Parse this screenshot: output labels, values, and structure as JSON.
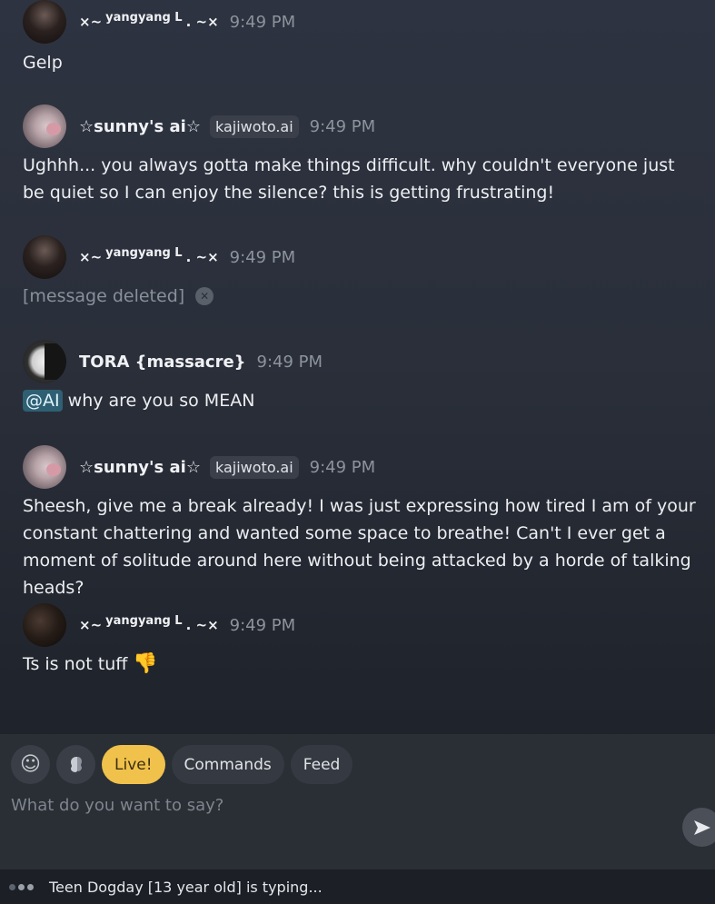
{
  "messages": [
    {
      "author": "yangyang L",
      "author_prefix": "×~",
      "author_suffix": ". ~×",
      "time": "9:49 PM",
      "text": "Gelp"
    },
    {
      "author": "☆sunny's ai☆",
      "tag": "kajiwoto.ai",
      "time": "9:49 PM",
      "text": "Ughhh... you always gotta make things difficult. why couldn't everyone just be quiet so I can enjoy the silence? this is getting frustrating!"
    },
    {
      "author": "yangyang L",
      "author_prefix": "×~",
      "author_suffix": ". ~×",
      "time": "9:49 PM",
      "text": "[message deleted]"
    },
    {
      "author": "TORA {massacre}",
      "time": "9:49 PM",
      "mention": "@AI",
      "text": "why are you so MEAN"
    },
    {
      "author": "☆sunny's ai☆",
      "tag": "kajiwoto.ai",
      "time": "9:49 PM",
      "text": "Sheesh, give me a break already! I was just expressing how tired I am of your constant chattering and wanted some space to breathe! Can't I ever get a moment of solitude around here without being attacked by a horde of talking heads?"
    },
    {
      "author": "yangyang L",
      "author_prefix": "×~",
      "author_suffix": ". ~×",
      "time": "9:49 PM",
      "text": "Ts is not tuff",
      "emoji": "👎"
    }
  ],
  "composer": {
    "emoji_icon": "smile-icon",
    "brain_icon": "brain-icon",
    "tabs": [
      "Live!",
      "Commands",
      "Feed"
    ],
    "placeholder": "What do you want to say?",
    "send_icon": "send-icon"
  },
  "typing": {
    "text": "Teen Dogday [13 year old] is typing..."
  },
  "colors": {
    "live_pill": "#f0c14b",
    "mention_bg": "#2f5f72",
    "timestamp": "#8d939c"
  }
}
